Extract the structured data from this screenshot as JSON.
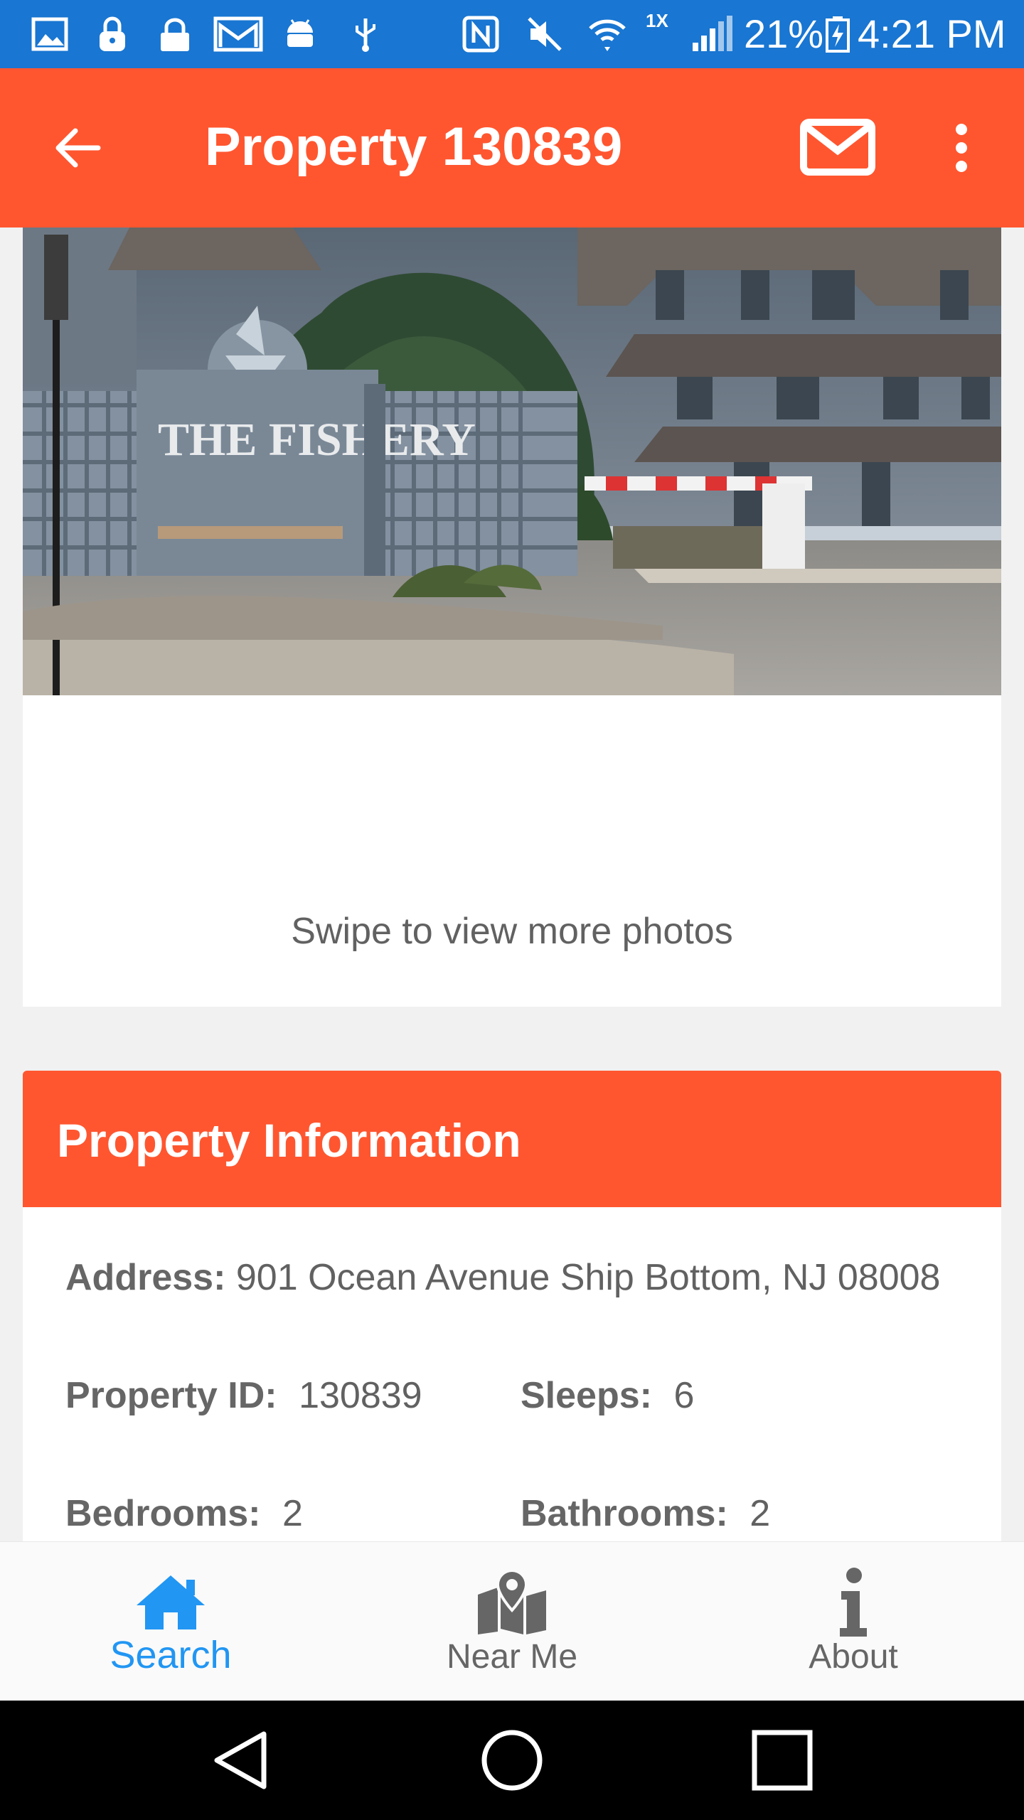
{
  "status_bar": {
    "network_speed": "1X",
    "battery": "21%",
    "time": "4:21 PM",
    "color": "#1976d2"
  },
  "app_bar": {
    "title": "Property 130839",
    "color": "#ff5630",
    "icons": [
      "back-arrow-icon",
      "mail-icon",
      "more-vert-icon"
    ]
  },
  "gallery": {
    "photo_sign_text": "THE FISHERY",
    "hint": "Swipe to view more photos"
  },
  "property_info": {
    "header": "Property Information",
    "address_label": "Address:",
    "address_value": "901 Ocean Avenue Ship Bottom, NJ 08008",
    "id_label": "Property ID:",
    "id_value": "130839",
    "sleeps_label": "Sleeps:",
    "sleeps_value": "6",
    "bedrooms_label": "Bedrooms:",
    "bedrooms_value": "2",
    "bathrooms_label": "Bathrooms:",
    "bathrooms_value": "2"
  },
  "bottom_nav": {
    "items": [
      {
        "label": "Search",
        "icon": "home-icon",
        "active": true
      },
      {
        "label": "Near Me",
        "icon": "map-marker-icon",
        "active": false
      },
      {
        "label": "About",
        "icon": "info-icon",
        "active": false
      }
    ],
    "active_color": "#2196f3"
  }
}
